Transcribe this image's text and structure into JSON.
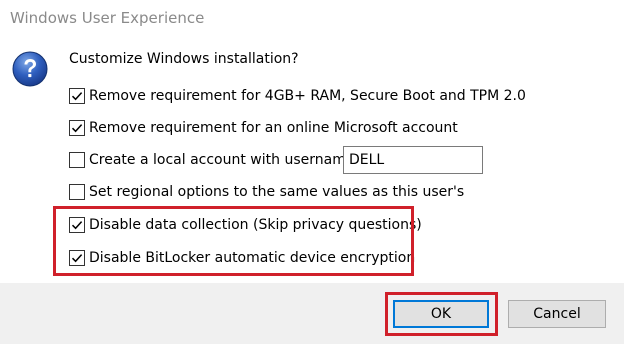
{
  "window": {
    "title": "Windows User Experience"
  },
  "dialog": {
    "icon": "question-icon",
    "heading": "Customize Windows installation?",
    "options": [
      {
        "label": "Remove requirement for 4GB+ RAM, Secure Boot and TPM 2.0",
        "checked": true
      },
      {
        "label": "Remove requirement for an online Microsoft account",
        "checked": true
      },
      {
        "label": "Create a local account with username:",
        "checked": false
      },
      {
        "label": "Set regional options to the same values as this user's",
        "checked": false
      },
      {
        "label": "Disable data collection (Skip privacy questions)",
        "checked": true
      },
      {
        "label": "Disable BitLocker automatic device encryption",
        "checked": true
      }
    ],
    "username_value": "DELL"
  },
  "buttons": {
    "ok_label": "OK",
    "cancel_label": "Cancel"
  },
  "colors": {
    "highlight": "#d0202a",
    "accent": "#0078d7",
    "footer_bg": "#f0f0f0"
  }
}
